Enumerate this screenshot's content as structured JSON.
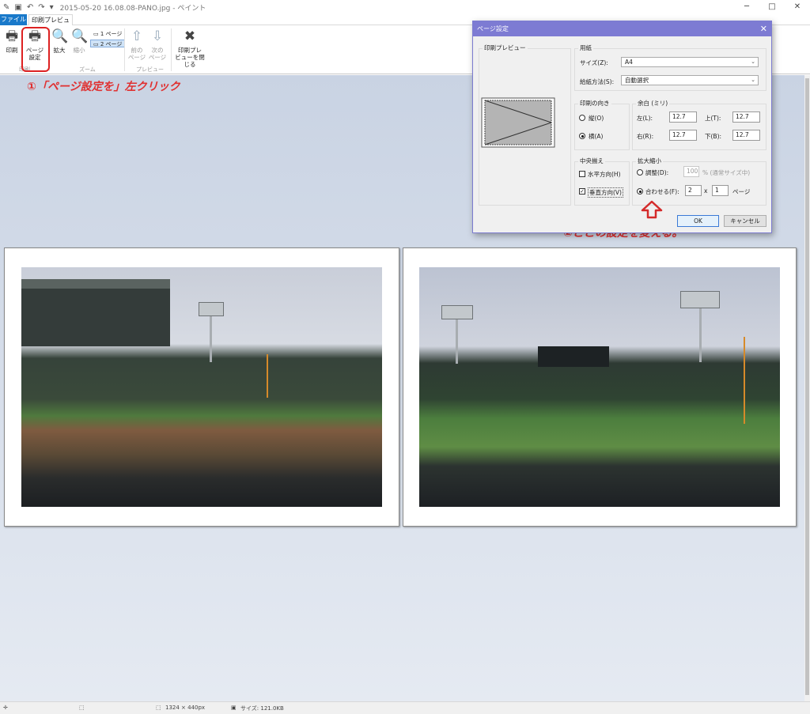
{
  "window": {
    "title": "2015-05-20 16.08.08-PANO.jpg - ペイント",
    "minimize": "─",
    "maximize": "□",
    "close": "✕"
  },
  "tabs": {
    "file": "ファイル",
    "print_preview": "印刷プレビュー"
  },
  "ribbon": {
    "print": "印刷",
    "page_setup_1": "ページ",
    "page_setup_2": "設定",
    "group_print": "印刷",
    "zoom_in": "拡大",
    "zoom_out": "縮小",
    "one_page": "1 ページ",
    "two_pages": "2 ページ",
    "group_zoom": "ズーム",
    "prev_1": "前の",
    "prev_2": "ページ",
    "next_1": "次の",
    "next_2": "ページ",
    "group_preview": "プレビュー",
    "close_1": "印刷プレ",
    "close_2": "ビューを閉じる"
  },
  "annotations": {
    "step1": "①「ページ設定を」左クリック",
    "step2": "②ここの設定を変える。"
  },
  "dialog": {
    "title": "ページ設定",
    "preview_label": "印刷プレビュー",
    "paper_label": "用紙",
    "size_label": "サイズ(Z):",
    "size_value": "A4",
    "source_label": "給紙方法(S):",
    "source_value": "自動選択",
    "orientation_label": "印刷の向き",
    "portrait": "縦(O)",
    "landscape": "横(A)",
    "margins_label": "余白 (ミリ)",
    "left_label": "左(L):",
    "left_value": "12.7",
    "top_label": "上(T):",
    "top_value": "12.7",
    "right_label": "右(R):",
    "right_value": "12.7",
    "bottom_label": "下(B):",
    "bottom_value": "12.7",
    "centering_label": "中央揃え",
    "horizontal": "水平方向(H)",
    "vertical": "垂直方向(V)",
    "scaling_label": "拡大縮小",
    "adjust": "調整(D):",
    "adjust_value": "100",
    "adjust_suffix": "% (通常サイズ中)",
    "fit": "合わせる(F):",
    "fit_x": "2",
    "fit_by": "x",
    "fit_y": "1",
    "fit_suffix": "ページ",
    "ok": "OK",
    "cancel": "キャンセル"
  },
  "status": {
    "dimensions": "1324 × 440px",
    "size": "サイズ: 121.0KB"
  },
  "colors": {
    "annotation": "#e03030",
    "file_tab": "#1979ca",
    "dialog_title": "#7d7bd3"
  }
}
